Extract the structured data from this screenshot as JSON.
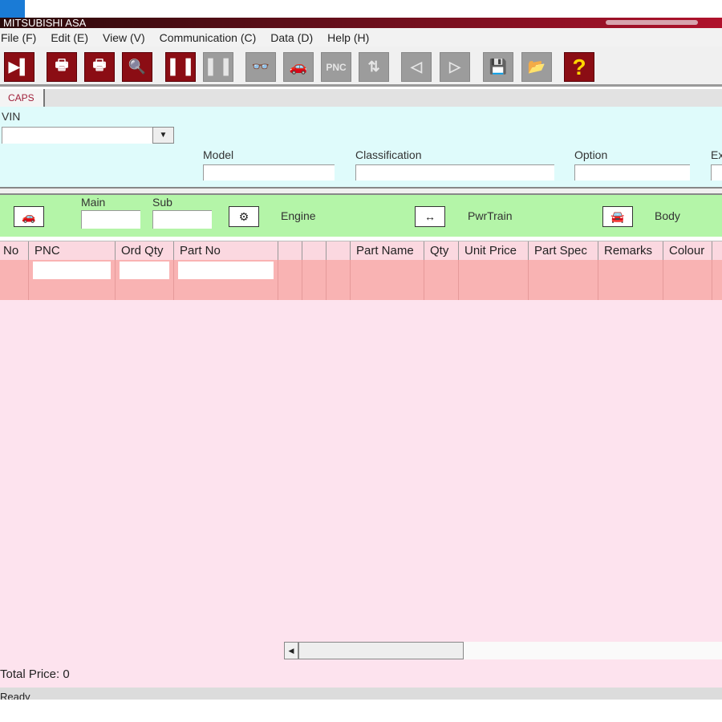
{
  "window": {
    "title": "MITSUBISHI ASA"
  },
  "menu": [
    "File (F)",
    "Edit (E)",
    "View (V)",
    "Communication (C)",
    "Data (D)",
    "Help (H)"
  ],
  "toolbar": [
    {
      "name": "exit",
      "glyph": "▶▌",
      "active": true
    },
    {
      "name": "print-screen",
      "glyph": "🖶",
      "active": true
    },
    {
      "name": "print",
      "glyph": "🖶",
      "active": true
    },
    {
      "name": "print-preview",
      "glyph": "🔍",
      "active": true
    },
    {
      "name": "parts-list",
      "glyph": "▌▐",
      "active": true
    },
    {
      "name": "copy-list",
      "glyph": "▌▐",
      "active": false
    },
    {
      "name": "search",
      "glyph": "👓",
      "active": false
    },
    {
      "name": "vehicle",
      "glyph": "🚗",
      "active": false
    },
    {
      "name": "pnc",
      "glyph": "PNC",
      "active": false
    },
    {
      "name": "exchange",
      "glyph": "⇅",
      "active": false
    },
    {
      "name": "previous",
      "glyph": "◁",
      "active": false
    },
    {
      "name": "next",
      "glyph": "▷",
      "active": false
    },
    {
      "name": "save",
      "glyph": "💾",
      "active": false
    },
    {
      "name": "open",
      "glyph": "📂",
      "active": false
    },
    {
      "name": "help",
      "glyph": "?",
      "active": true
    }
  ],
  "tab": "CAPS",
  "vin": {
    "label": "VIN",
    "value": ""
  },
  "fields": {
    "model": "Model",
    "classification": "Classification",
    "option": "Option",
    "ext": "Ex"
  },
  "group": {
    "main": "Main",
    "sub": "Sub",
    "engine": "Engine",
    "pwrtrain": "PwrTrain",
    "body": "Body"
  },
  "table": {
    "headers": [
      "No",
      "PNC",
      "Ord Qty",
      "Part No",
      "",
      "",
      "",
      "Part Name",
      "Qty",
      "Unit Price",
      "Part Spec",
      "Remarks",
      "Colour",
      ""
    ]
  },
  "total": "Total Price: 0",
  "status": "Ready"
}
